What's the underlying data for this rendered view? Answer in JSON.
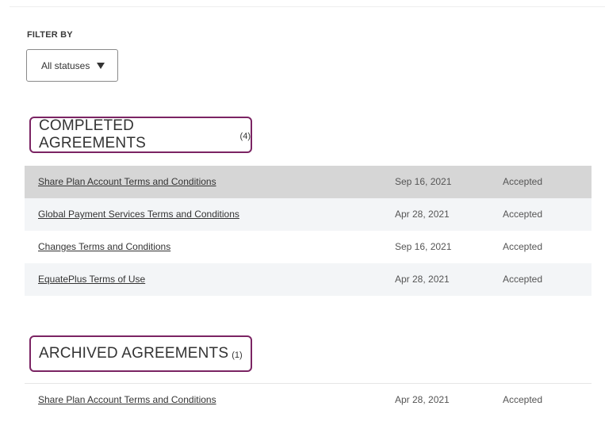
{
  "filter": {
    "label": "FILTER BY",
    "selected": "All statuses"
  },
  "completed": {
    "title": "COMPLETED AGREEMENTS",
    "count": "(4)",
    "rows": [
      {
        "name": "Share Plan Account Terms and Conditions",
        "date": "Sep 16, 2021",
        "status": "Accepted"
      },
      {
        "name": "Global Payment Services Terms and Conditions",
        "date": "Apr 28, 2021",
        "status": "Accepted"
      },
      {
        "name": "Changes Terms and Conditions",
        "date": "Sep 16, 2021",
        "status": "Accepted"
      },
      {
        "name": "EquatePlus Terms of Use",
        "date": "Apr 28, 2021",
        "status": "Accepted"
      }
    ]
  },
  "archived": {
    "title": "ARCHIVED AGREEMENTS",
    "count": "(1)",
    "rows": [
      {
        "name": "Share Plan Account Terms and Conditions",
        "date": "Apr 28, 2021",
        "status": "Accepted"
      }
    ]
  },
  "colors": {
    "accent": "#7b2463",
    "hover_row": "#d6d6d6",
    "stripe_row": "#f3f5f7"
  },
  "icons": {
    "dropdown": "caret-down-icon"
  }
}
